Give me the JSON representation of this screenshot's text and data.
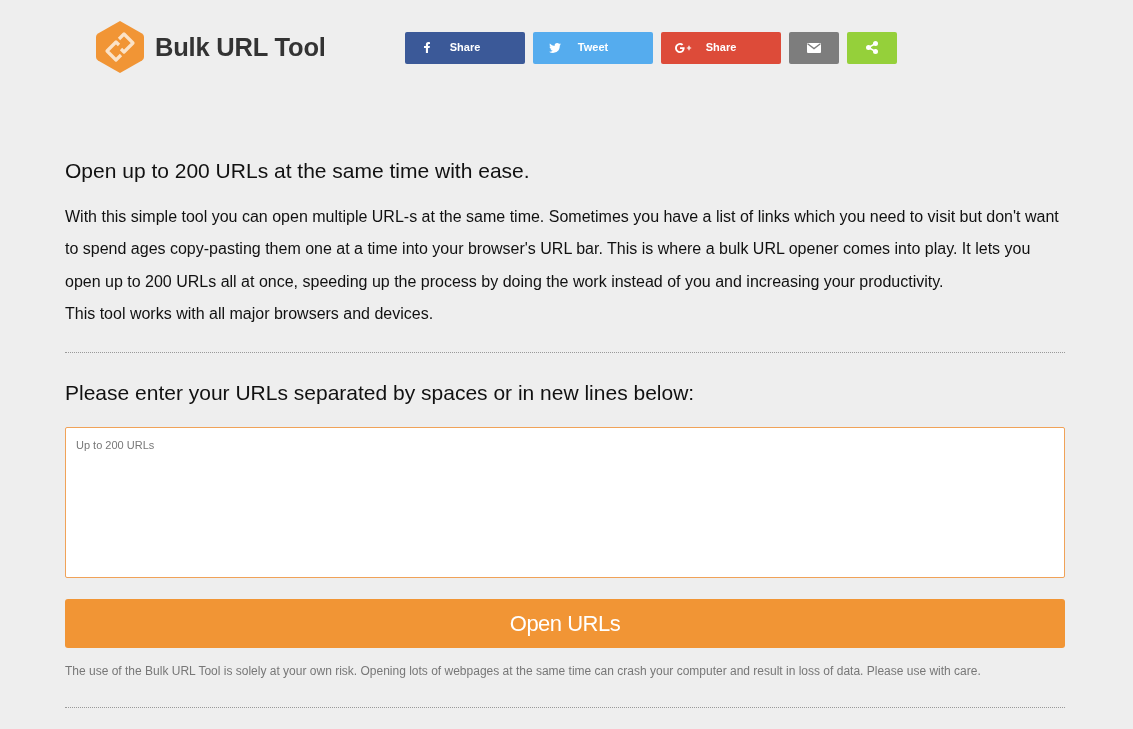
{
  "header": {
    "logo_text": "Bulk URL Tool",
    "share_buttons": [
      {
        "kind": "facebook",
        "label": "Share",
        "color": "#3b5998"
      },
      {
        "kind": "twitter",
        "label": "Tweet",
        "color": "#55acee"
      },
      {
        "kind": "googleplus",
        "label": "Share",
        "color": "#dd4b39"
      },
      {
        "kind": "email",
        "color": "#7d7d7d"
      },
      {
        "kind": "share",
        "color": "#95d03a"
      }
    ]
  },
  "intro": {
    "heading": "Open up to 200 URLs at the same time with ease.",
    "paragraphs": [
      "With this simple tool you can open multiple URL-s at the same time. Sometimes you have a list of links which you need to visit but don't want to spend ages copy-pasting them one at a time into your browser's URL bar. This is where a bulk URL opener comes into play. It lets you open up to 200 URLs all at once, speeding up the process by doing the work instead of you and increasing your productivity.",
      "This tool works with all major browsers and devices."
    ]
  },
  "form": {
    "heading": "Please enter your URLs separated by spaces or in new lines below:",
    "urls_field": {
      "placeholder": "Up to 200 URLs"
    },
    "submit_button": "Open URLs",
    "disclaimer": "The use of the Bulk URL Tool is solely at your own risk. Opening lots of webpages at the same time can crash your computer and result in loss of data. Please use with care."
  }
}
